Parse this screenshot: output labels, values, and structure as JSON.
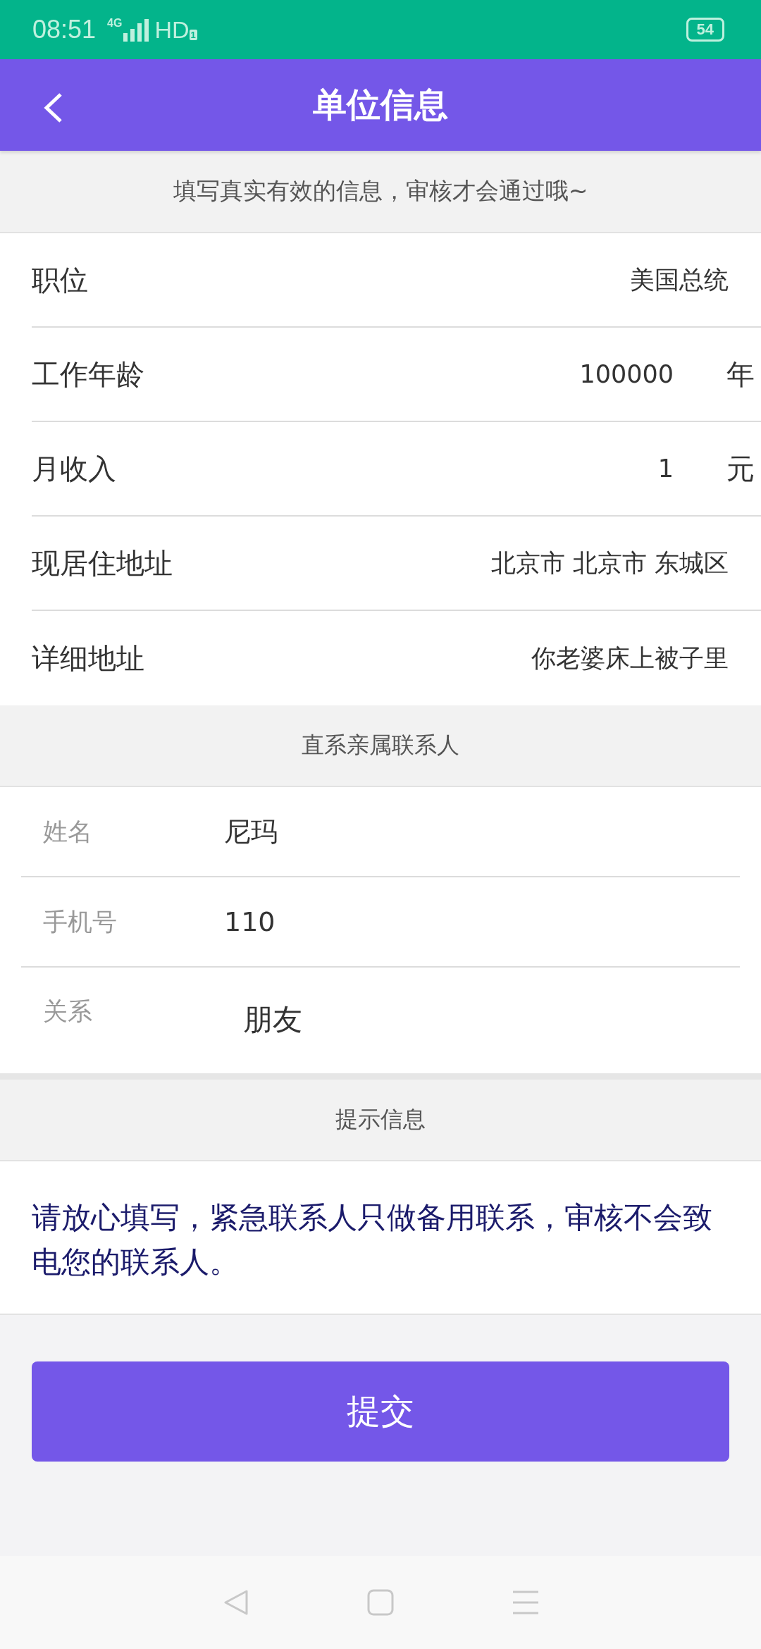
{
  "status_bar": {
    "time": "08:51",
    "network": "4G",
    "hd": "HD",
    "sim": "1",
    "battery": "54"
  },
  "header": {
    "title": "单位信息"
  },
  "notice": "填写真实有效的信息，审核才会通过哦~",
  "work_rows": [
    {
      "label": "职位",
      "value": "美国总统"
    },
    {
      "label": "工作年龄",
      "value": "100000",
      "unit": "年"
    },
    {
      "label": "月收入",
      "value": "1",
      "unit": "元"
    },
    {
      "label": "现居住地址",
      "value": "北京市 北京市 东城区"
    },
    {
      "label": "详细地址",
      "value": "你老婆床上被子里"
    }
  ],
  "contact_section": {
    "title": "直系亲属联系人"
  },
  "contact_rows": [
    {
      "kind": "input",
      "label": "姓名",
      "value": "尼玛"
    },
    {
      "kind": "input",
      "label": "手机号",
      "value": "110"
    },
    {
      "kind": "picker",
      "label": "关系",
      "value": "朋友"
    }
  ],
  "tip_section": {
    "title": "提示信息",
    "text": "请放心填写，紧急联系人只做备用联系，审核不会致电您的联系人。"
  },
  "submit_button": "提交"
}
